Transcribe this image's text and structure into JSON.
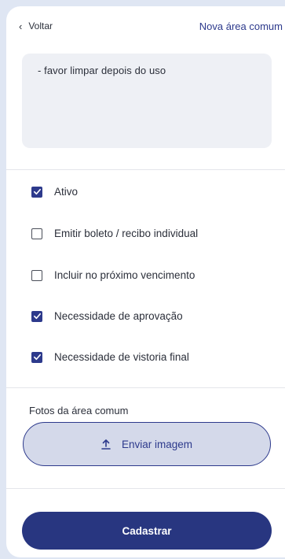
{
  "header": {
    "back_label": "Voltar",
    "title": "Nova área comum"
  },
  "description": {
    "value": "- favor limpar depois do uso"
  },
  "options": [
    {
      "label": "Ativo",
      "checked": true
    },
    {
      "label": "Emitir boleto / recibo individual",
      "checked": false
    },
    {
      "label": "Incluir no próximo vencimento",
      "checked": false
    },
    {
      "label": "Necessidade de aprovação",
      "checked": true
    },
    {
      "label": "Necessidade de vistoria final",
      "checked": true
    }
  ],
  "photos": {
    "section_label": "Fotos da área comum",
    "upload_label": "Enviar imagem",
    "upload_icon": "upload-icon"
  },
  "submit_label": "Cadastrar",
  "colors": {
    "primary": "#283680",
    "upload_bg": "#d4d9ea",
    "field_bg": "#eef0f5"
  }
}
